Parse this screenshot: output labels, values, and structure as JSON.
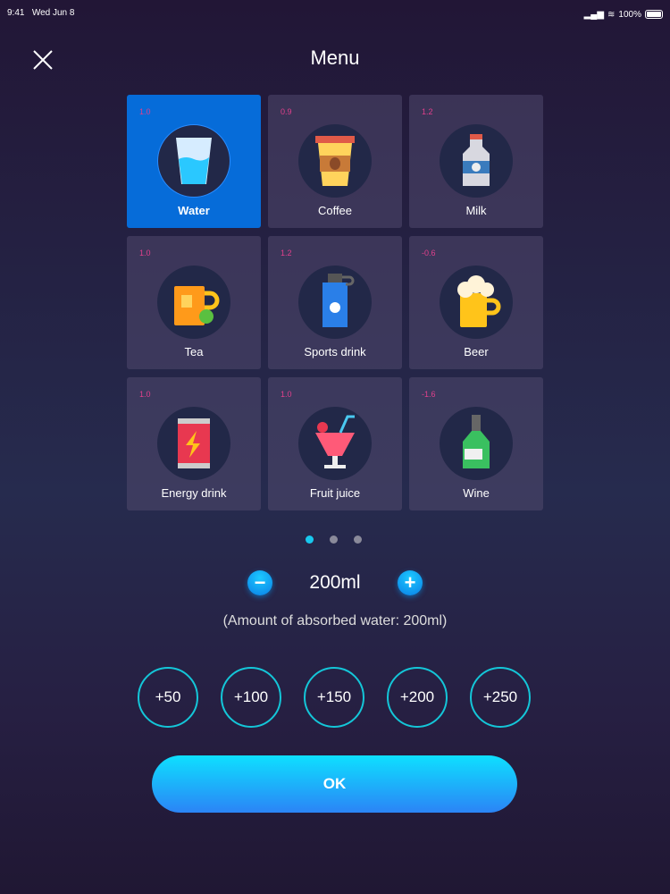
{
  "status": {
    "time": "9:41",
    "date": "Wed Jun 8",
    "battery": "100%"
  },
  "header": {
    "title": "Menu"
  },
  "drinks": [
    {
      "label": "Water",
      "factor": "1.0",
      "icon": "water-glass-icon",
      "selected": true
    },
    {
      "label": "Coffee",
      "factor": "0.9",
      "icon": "coffee-cup-icon"
    },
    {
      "label": "Milk",
      "factor": "1.2",
      "icon": "milk-bottle-icon"
    },
    {
      "label": "Tea",
      "factor": "1.0",
      "icon": "tea-mug-icon"
    },
    {
      "label": "Sports drink",
      "factor": "1.2",
      "icon": "sports-bottle-icon"
    },
    {
      "label": "Beer",
      "factor": "-0.6",
      "icon": "beer-mug-icon"
    },
    {
      "label": "Energy drink",
      "factor": "1.0",
      "icon": "energy-can-icon"
    },
    {
      "label": "Fruit juice",
      "factor": "1.0",
      "icon": "juice-glass-icon"
    },
    {
      "label": "Wine",
      "factor": "-1.6",
      "icon": "wine-bottle-icon"
    }
  ],
  "pager": {
    "pages": 3,
    "current": 1
  },
  "amount": {
    "value": "200ml",
    "absorbed": "(Amount of absorbed water: 200ml)"
  },
  "quick_add": [
    "+50",
    "+100",
    "+150",
    "+200",
    "+250"
  ],
  "ok_label": "OK",
  "colors": {
    "accent": "#18c8ee",
    "selected": "#066cd9",
    "factor": "#e0408c"
  }
}
